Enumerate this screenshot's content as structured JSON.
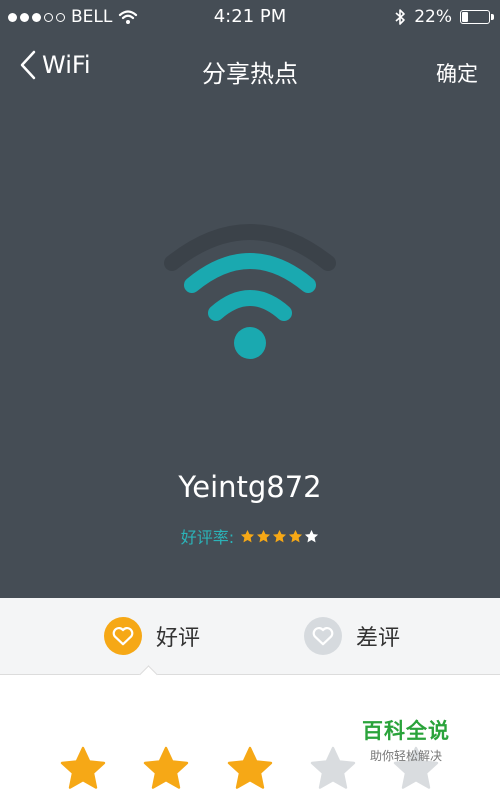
{
  "status_bar": {
    "carrier": "BELL",
    "signal_bars_filled": 3,
    "signal_bars_total": 5,
    "time": "4:21 PM",
    "battery_percent": "22%",
    "battery_level": 0.22,
    "icons": [
      "wifi-icon",
      "bluetooth-icon",
      "battery-icon"
    ]
  },
  "nav": {
    "back_label": "WiFi",
    "title": "分享热点",
    "confirm_label": "确定"
  },
  "hotspot": {
    "ssid": "Yeintg872",
    "rating_label": "好评率:",
    "rating_value": 4,
    "rating_max": 5
  },
  "tabs": [
    {
      "label": "好评",
      "selected": true,
      "icon": "heart-icon"
    },
    {
      "label": "差评",
      "selected": false,
      "icon": "heart-icon"
    }
  ],
  "review": {
    "stars_selected": 3,
    "stars_total": 5
  },
  "watermark": {
    "title": "百科全说",
    "subtitle": "助你轻松解决"
  },
  "colors": {
    "background_dark": "#454d55",
    "accent_teal": "#1aa9b0",
    "star_gold": "#f6a816",
    "star_gray": "#d9dcdf",
    "watermark_green": "#2aa33b"
  }
}
